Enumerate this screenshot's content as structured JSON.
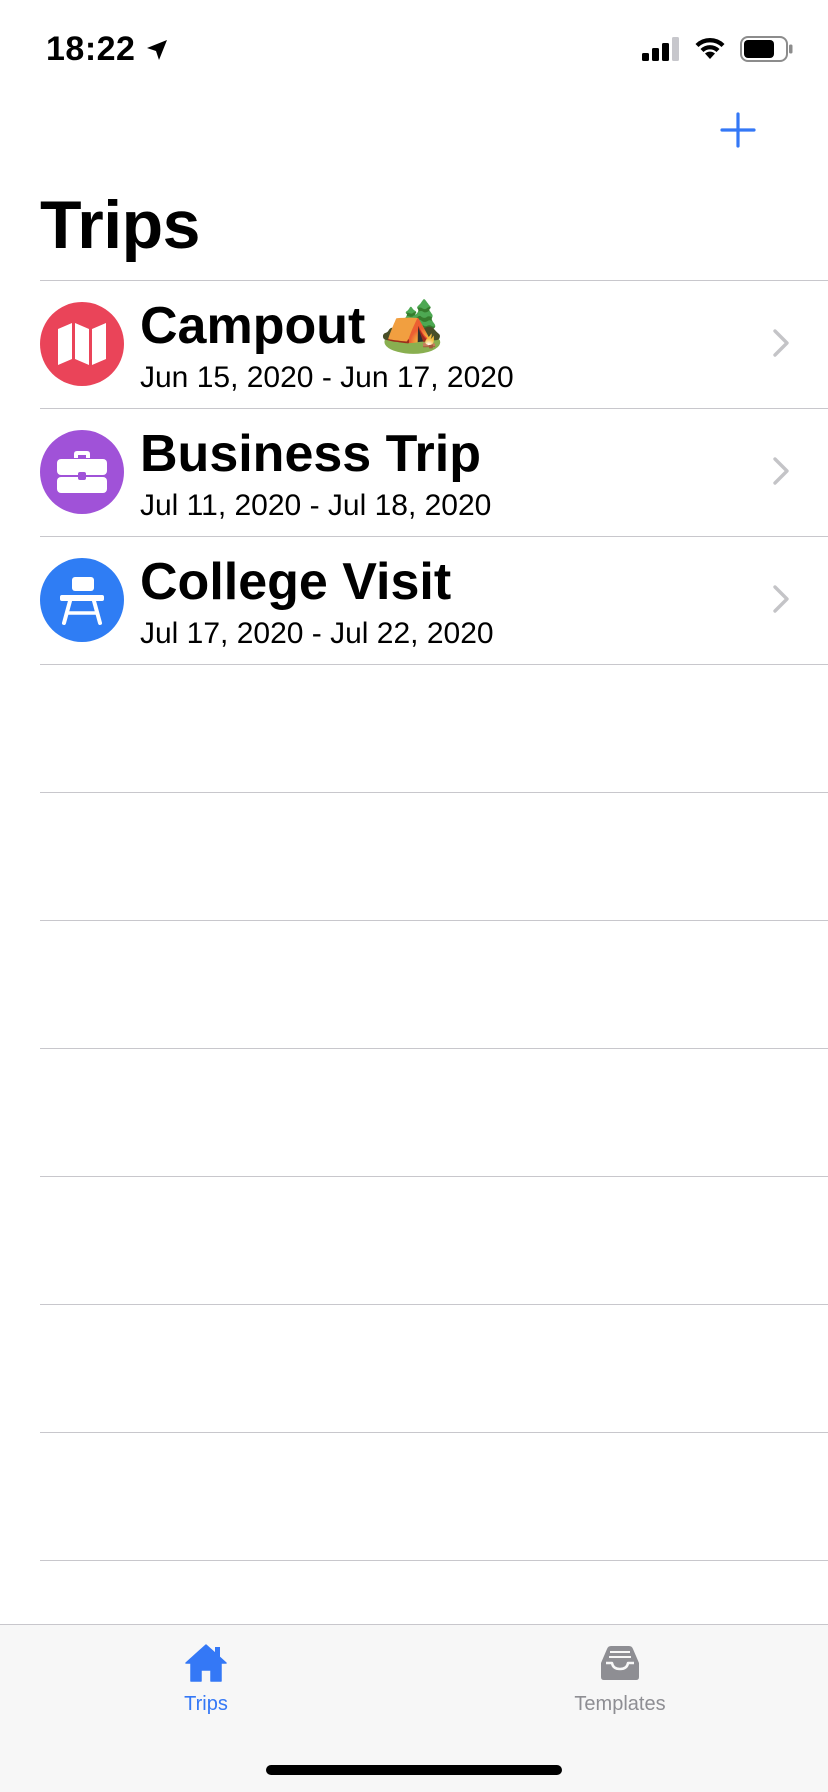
{
  "status_bar": {
    "time": "18:22",
    "icons": [
      "location-arrow-icon",
      "signal-icon",
      "wifi-icon",
      "battery-icon"
    ]
  },
  "nav": {
    "title": "Trips",
    "add_icon": "plus-icon"
  },
  "colors": {
    "accent": "#3478f6",
    "campout_icon": "#ea4459",
    "business_icon": "#a052d8",
    "college_icon": "#2f7df4",
    "separator": "#c8c7cc",
    "inactive_tab": "#8e8e93"
  },
  "trips": [
    {
      "title": "Campout 🏕️",
      "dates": "Jun 15, 2020 - Jun 17, 2020",
      "icon": "map-icon"
    },
    {
      "title": "Business Trip",
      "dates": "Jul 11, 2020 - Jul 18, 2020",
      "icon": "briefcase-icon"
    },
    {
      "title": "College Visit",
      "dates": "Jul 17, 2020 - Jul 22, 2020",
      "icon": "school-desk-icon"
    }
  ],
  "tab_bar": {
    "tabs": [
      {
        "label": "Trips",
        "icon": "house-icon",
        "selected": true
      },
      {
        "label": "Templates",
        "icon": "tray-icon",
        "selected": false
      }
    ]
  }
}
